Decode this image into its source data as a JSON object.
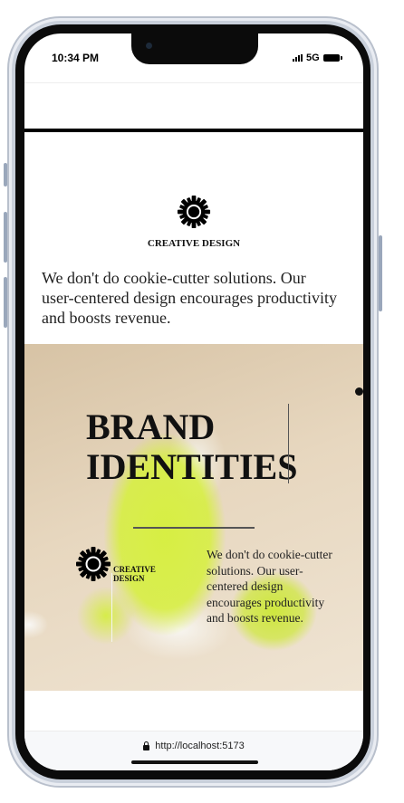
{
  "status_bar": {
    "time": "10:34 PM",
    "network": "5G"
  },
  "section_intro": {
    "icon": "sun-gear-icon",
    "label": "CREATIVE DESIGN",
    "text": "We don't do cookie-cutter solutions. Our user-centered design encourages productivity and boosts revenue."
  },
  "hero": {
    "title_line1": "BRAND",
    "title_line2": "IDENTITIES",
    "label_line1": "CREATIVE",
    "label_line2": "DESIGN",
    "text": "We don't do cookie-cutter solutions. Our user-centered design encourages productivity and boosts revenue."
  },
  "browser": {
    "url": "http://localhost:5173"
  },
  "colors": {
    "accent_lime": "#d6f03c",
    "hero_bg": "#e7d7bf",
    "text": "#111111"
  }
}
